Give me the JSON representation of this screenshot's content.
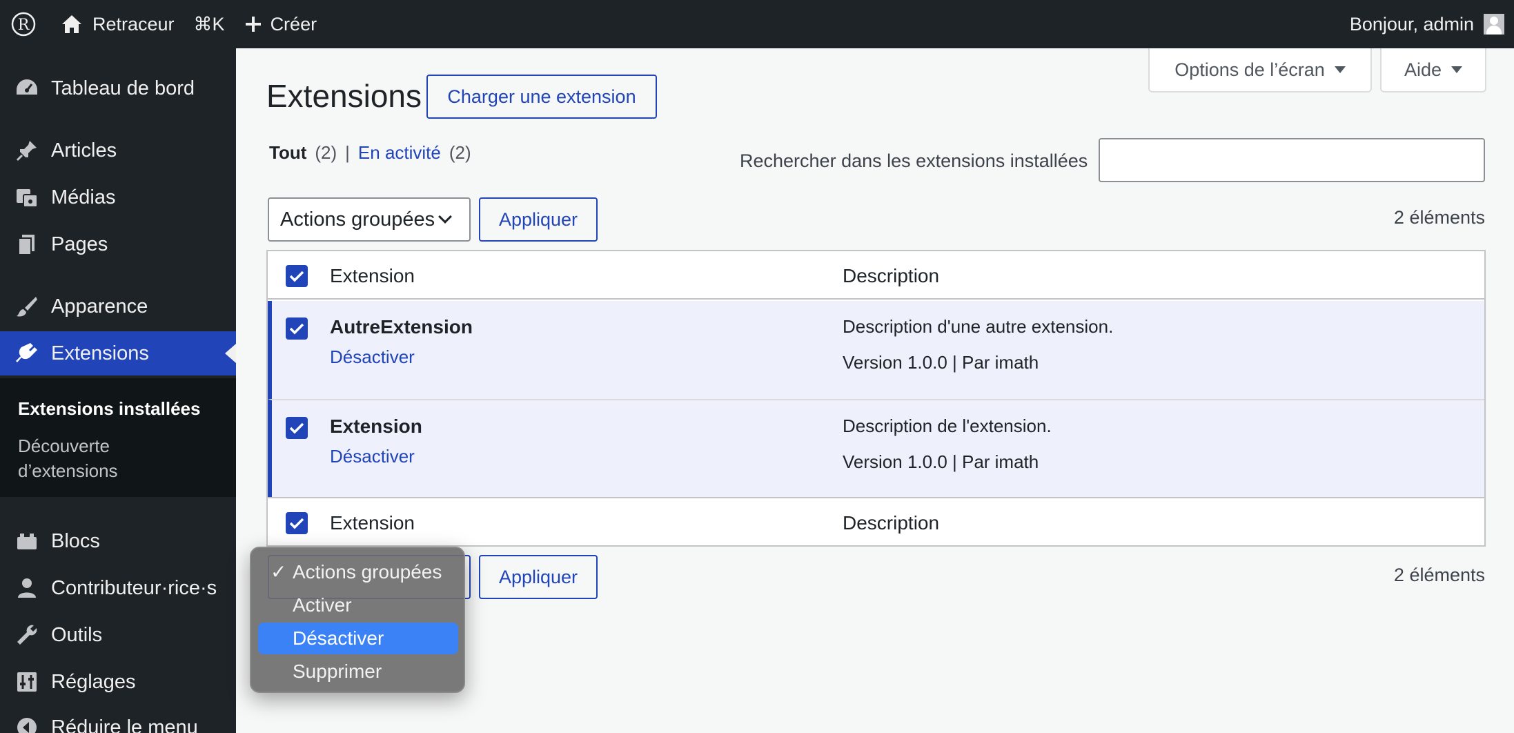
{
  "adminbar": {
    "site_name": "Retraceur",
    "shortcut": "⌘K",
    "new_label": "Créer",
    "greeting": "Bonjour, admin"
  },
  "sidebar": {
    "items": [
      {
        "label": "Tableau de bord",
        "icon": "dashboard-icon"
      },
      {
        "label": "Articles",
        "icon": "pushpin-icon"
      },
      {
        "label": "Médias",
        "icon": "media-icon"
      },
      {
        "label": "Pages",
        "icon": "pages-icon"
      },
      {
        "label": "Apparence",
        "icon": "brush-icon"
      },
      {
        "label": "Extensions",
        "icon": "plugin-icon"
      },
      {
        "label": "Blocs",
        "icon": "blocks-icon"
      },
      {
        "label": "Contributeur·rice·s",
        "icon": "user-icon"
      },
      {
        "label": "Outils",
        "icon": "wrench-icon"
      },
      {
        "label": "Réglages",
        "icon": "settings-icon"
      },
      {
        "label": "Réduire le menu",
        "icon": "collapse-icon"
      }
    ],
    "submenu": {
      "installed": "Extensions installées",
      "discover_line1": "Découverte",
      "discover_line2": "d’extensions"
    }
  },
  "main": {
    "title": "Extensions",
    "upload_button": "Charger une extension",
    "screen_options": "Options de l’écran",
    "help": "Aide",
    "filters": {
      "all_label": "Tout",
      "all_count": "(2)",
      "separator": "|",
      "active_label": "En activité",
      "active_count": "(2)"
    },
    "search_label": "Rechercher dans les extensions installées",
    "search_value": "",
    "bulk_select_value": "Actions groupées",
    "apply_label": "Appliquer",
    "count_label": "2 éléments",
    "table": {
      "col_name": "Extension",
      "col_desc": "Description",
      "rows": [
        {
          "name": "AutreExtension",
          "action": "Désactiver",
          "description": "Description d'une autre extension.",
          "meta": "Version 1.0.0 | Par imath"
        },
        {
          "name": "Extension",
          "action": "Désactiver",
          "description": "Description de l'extension.",
          "meta": "Version 1.0.0 | Par imath"
        }
      ]
    },
    "dropdown": {
      "options": [
        "Actions groupées",
        "Activer",
        "Désactiver",
        "Supprimer"
      ],
      "checked": "Actions groupées",
      "highlighted": "Désactiver"
    }
  },
  "colors": {
    "accent": "#2145b8",
    "adminbar": "#1d2327",
    "highlight": "#3b82f6"
  }
}
